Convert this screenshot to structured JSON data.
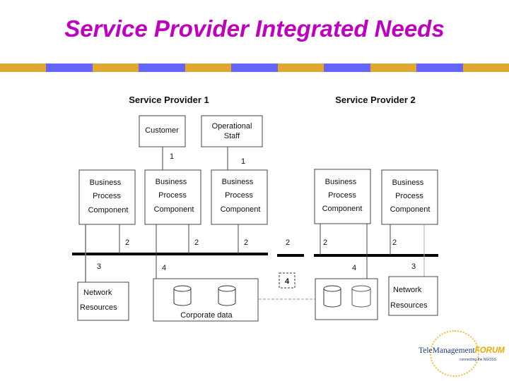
{
  "slide": {
    "title": "Service Provider Integrated Needs",
    "stripe_colors": [
      "#e0a830",
      "#6666ff"
    ]
  },
  "diagram": {
    "provider1": {
      "heading": "Service Provider 1",
      "customer": "Customer",
      "operational_staff": [
        "Operational",
        "Staff"
      ],
      "bpc": [
        [
          "Business",
          "Process",
          "Component"
        ],
        [
          "Business",
          "Process",
          "Component"
        ],
        [
          "Business",
          "Process",
          "Component"
        ]
      ],
      "network_resources": [
        "Network",
        "Resources"
      ],
      "corporate_data": "Corporate data"
    },
    "provider2": {
      "heading": "Service Provider 2",
      "bpc": [
        [
          "Business",
          "Process",
          "Component"
        ],
        [
          "Business",
          "Process",
          "Component"
        ]
      ],
      "network_resources": [
        "Network",
        "Resources"
      ]
    },
    "interface_labels": {
      "customer_link": "1",
      "staff_link": "1",
      "bus_links": [
        "2",
        "2",
        "2",
        "2",
        "2",
        "2"
      ],
      "network_link_left": "3",
      "network_link_right": "3",
      "data_link_left": "4",
      "data_link_right": "4",
      "inter_provider_data": "4"
    }
  },
  "logo": {
    "name_part1": "TeleManagement",
    "name_part2": "FORUM",
    "tagline": "connecting the NGOSS"
  }
}
